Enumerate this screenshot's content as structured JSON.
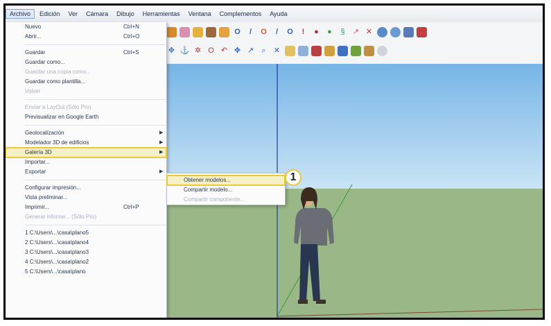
{
  "menubar": {
    "items": [
      {
        "label": "Archivo"
      },
      {
        "label": "Edición"
      },
      {
        "label": "Ver"
      },
      {
        "label": "Cámara"
      },
      {
        "label": "Dibujo"
      },
      {
        "label": "Herramientas"
      },
      {
        "label": "Ventana"
      },
      {
        "label": "Complementos"
      },
      {
        "label": "Ayuda"
      }
    ]
  },
  "file_menu": {
    "items": [
      {
        "label": "Nuevo",
        "shortcut": "Ctrl+N"
      },
      {
        "label": "Abrir...",
        "shortcut": "Ctrl+O"
      },
      {
        "label": "Guardar",
        "shortcut": "Ctrl+S"
      },
      {
        "label": "Guardar como..."
      },
      {
        "label": "Guardar una copia como..."
      },
      {
        "label": "Guardar como plantilla..."
      },
      {
        "label": "Volver"
      },
      {
        "label": "Enviar a LayOut (Sólo Pro)"
      },
      {
        "label": "Previsualizar en Google Earth"
      },
      {
        "label": "Geolocalización"
      },
      {
        "label": "Modelador 3D de edificios"
      },
      {
        "label": "Galería 3D"
      },
      {
        "label": "Importar..."
      },
      {
        "label": "Exportar"
      },
      {
        "label": "Configurar impresión..."
      },
      {
        "label": "Vista preliminar..."
      },
      {
        "label": "Imprimir...",
        "shortcut": "Ctrl+P"
      },
      {
        "label": "Generar informe... (Sólo Pro)"
      },
      {
        "label": "1 C:\\Users\\...\\casa\\plano5"
      },
      {
        "label": "2 C:\\Users\\...\\casa\\plano4"
      },
      {
        "label": "3 C:\\Users\\...\\casa\\plano3"
      },
      {
        "label": "4 C:\\Users\\...\\casa\\plano2"
      },
      {
        "label": "5 C:\\Users\\...\\casa\\plano"
      }
    ]
  },
  "gallery_submenu": {
    "items": [
      {
        "label": "Obtener modelos..."
      },
      {
        "label": "Compartir modelo..."
      },
      {
        "label": "Compartir componente..."
      }
    ]
  },
  "callout": {
    "number": "1"
  },
  "colors": {
    "highlight_border": "#e8c93a",
    "sky": "#77b5e6",
    "ground": "#9ab887",
    "blue_axis": "#1a3aa8",
    "green_axis": "#3a9a3a"
  }
}
